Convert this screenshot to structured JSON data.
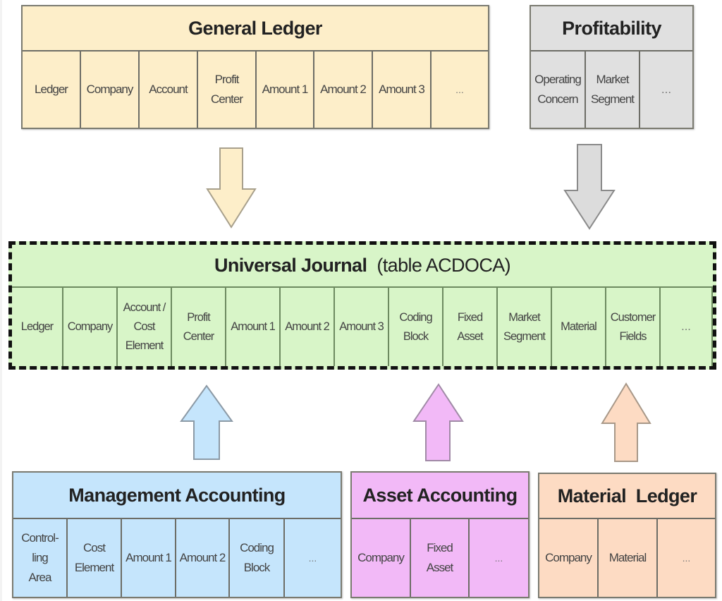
{
  "diagram": {
    "general_ledger": {
      "title": "General Ledger",
      "fields": [
        "Ledger",
        "Company",
        "Account",
        "Profit\nCenter",
        "Amount 1",
        "Amount 2",
        "Amount 3",
        "..."
      ],
      "color": "#fdeec9"
    },
    "profitability": {
      "title": "Profitability",
      "fields": [
        "Operating\nConcern",
        "Market\nSegment",
        "..."
      ],
      "color": "#e0e0e0"
    },
    "universal_journal": {
      "title": "Universal Journal",
      "subtitle": "(table ACDOCA)",
      "fields": [
        "Ledger",
        "Company",
        "Account /\nCost\nElement",
        "Profit\nCenter",
        "Amount 1",
        "Amount 2",
        "Amount 3",
        "Coding\nBlock",
        "Fixed\nAsset",
        "Market\nSegment",
        "Material",
        "Customer\nFields",
        "..."
      ],
      "color": "#d8f5c8"
    },
    "management_accounting": {
      "title": "Management Accounting",
      "fields": [
        "Control-\nling\nArea",
        "Cost\nElement",
        "Amount 1",
        "Amount 2",
        "Coding\nBlock",
        "..."
      ],
      "color": "#c5e5fc"
    },
    "asset_accounting": {
      "title": "Asset Accounting",
      "fields": [
        "Company",
        "Fixed\nAsset",
        "..."
      ],
      "color": "#f2b9f7"
    },
    "material_ledger": {
      "title": "Material  Ledger",
      "fields": [
        "Company",
        "Material",
        "..."
      ],
      "color": "#fddbc3"
    },
    "arrows": [
      {
        "from": "General Ledger",
        "to": "Universal Journal",
        "direction": "down",
        "color": "#fdeec9"
      },
      {
        "from": "Profitability",
        "to": "Universal Journal",
        "direction": "down",
        "color": "#e0e0e0"
      },
      {
        "from": "Management Accounting",
        "to": "Universal Journal",
        "direction": "up",
        "color": "#c5e5fc"
      },
      {
        "from": "Asset Accounting",
        "to": "Universal Journal",
        "direction": "up",
        "color": "#f2b9f7"
      },
      {
        "from": "Material Ledger",
        "to": "Universal Journal",
        "direction": "up",
        "color": "#fddbc3"
      }
    ]
  }
}
